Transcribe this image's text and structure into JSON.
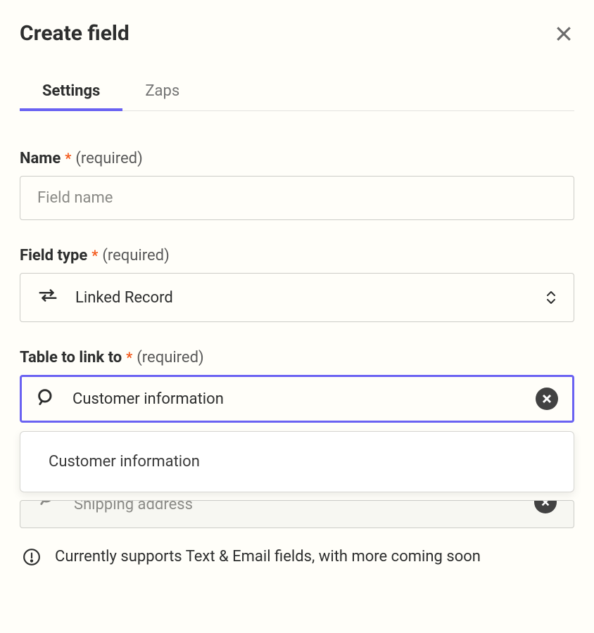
{
  "header": {
    "title": "Create field"
  },
  "tabs": [
    {
      "label": "Settings",
      "active": true
    },
    {
      "label": "Zaps",
      "active": false
    }
  ],
  "form": {
    "name": {
      "label": "Name",
      "required_text": "(required)",
      "placeholder": "Field name",
      "value": ""
    },
    "field_type": {
      "label": "Field type",
      "required_text": "(required)",
      "value": "Linked Record"
    },
    "table_link": {
      "label": "Table to link to",
      "required_text": "(required)",
      "search_value": "Customer information",
      "options": [
        "Customer information"
      ],
      "underlay_value": "Shipping address"
    }
  },
  "info": {
    "text": "Currently supports Text & Email fields, with more coming soon"
  }
}
